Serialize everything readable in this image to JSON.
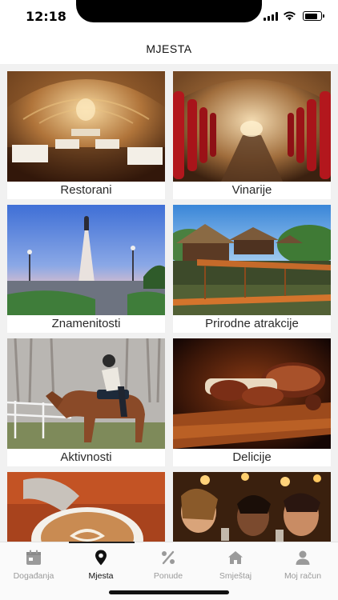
{
  "status": {
    "time": "12:18",
    "battery_level": 0.85
  },
  "header": {
    "title": "MJESTA"
  },
  "categories": [
    {
      "label": "Restorani"
    },
    {
      "label": "Vinarije"
    },
    {
      "label": "Znamenitosti"
    },
    {
      "label": "Prirodne atrakcije"
    },
    {
      "label": "Aktivnosti"
    },
    {
      "label": "Delicije"
    },
    {
      "label": ""
    },
    {
      "label": ""
    }
  ],
  "tabs": [
    {
      "label": "Događanja",
      "icon": "calendar-icon"
    },
    {
      "label": "Mjesta",
      "icon": "map-pin-icon",
      "active": true
    },
    {
      "label": "Ponude",
      "icon": "percent-icon"
    },
    {
      "label": "Smještaj",
      "icon": "home-icon"
    },
    {
      "label": "Moj račun",
      "icon": "user-icon"
    }
  ],
  "colors": {
    "active_tab": "#111111",
    "inactive_tab": "#9a9a9a",
    "grid_background": "#f1f1f1"
  }
}
